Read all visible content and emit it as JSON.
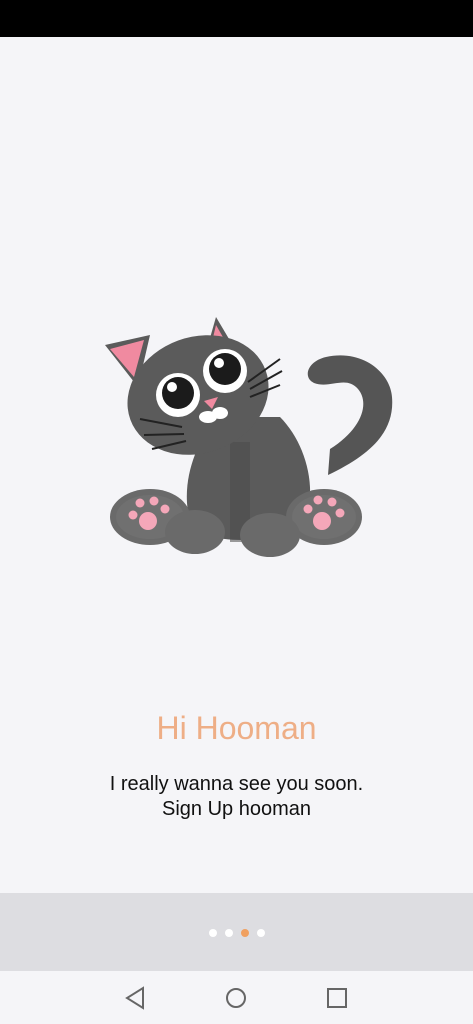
{
  "onboarding": {
    "title": "Hi Hooman",
    "subtitle_line1": "I really wanna see you soon.",
    "subtitle_line2": "Sign Up hooman",
    "page_indicator": {
      "total": 4,
      "active_index": 2
    }
  },
  "colors": {
    "title": "#eeae86",
    "active_dot": "#f0a060",
    "inactive_dot": "#ffffff",
    "background": "#f5f5f8",
    "pager_bar": "#dddde1"
  },
  "illustration": {
    "icon": "cat-illustration"
  },
  "nav_bar": {
    "buttons": [
      "back-icon",
      "home-icon",
      "recents-icon"
    ]
  }
}
